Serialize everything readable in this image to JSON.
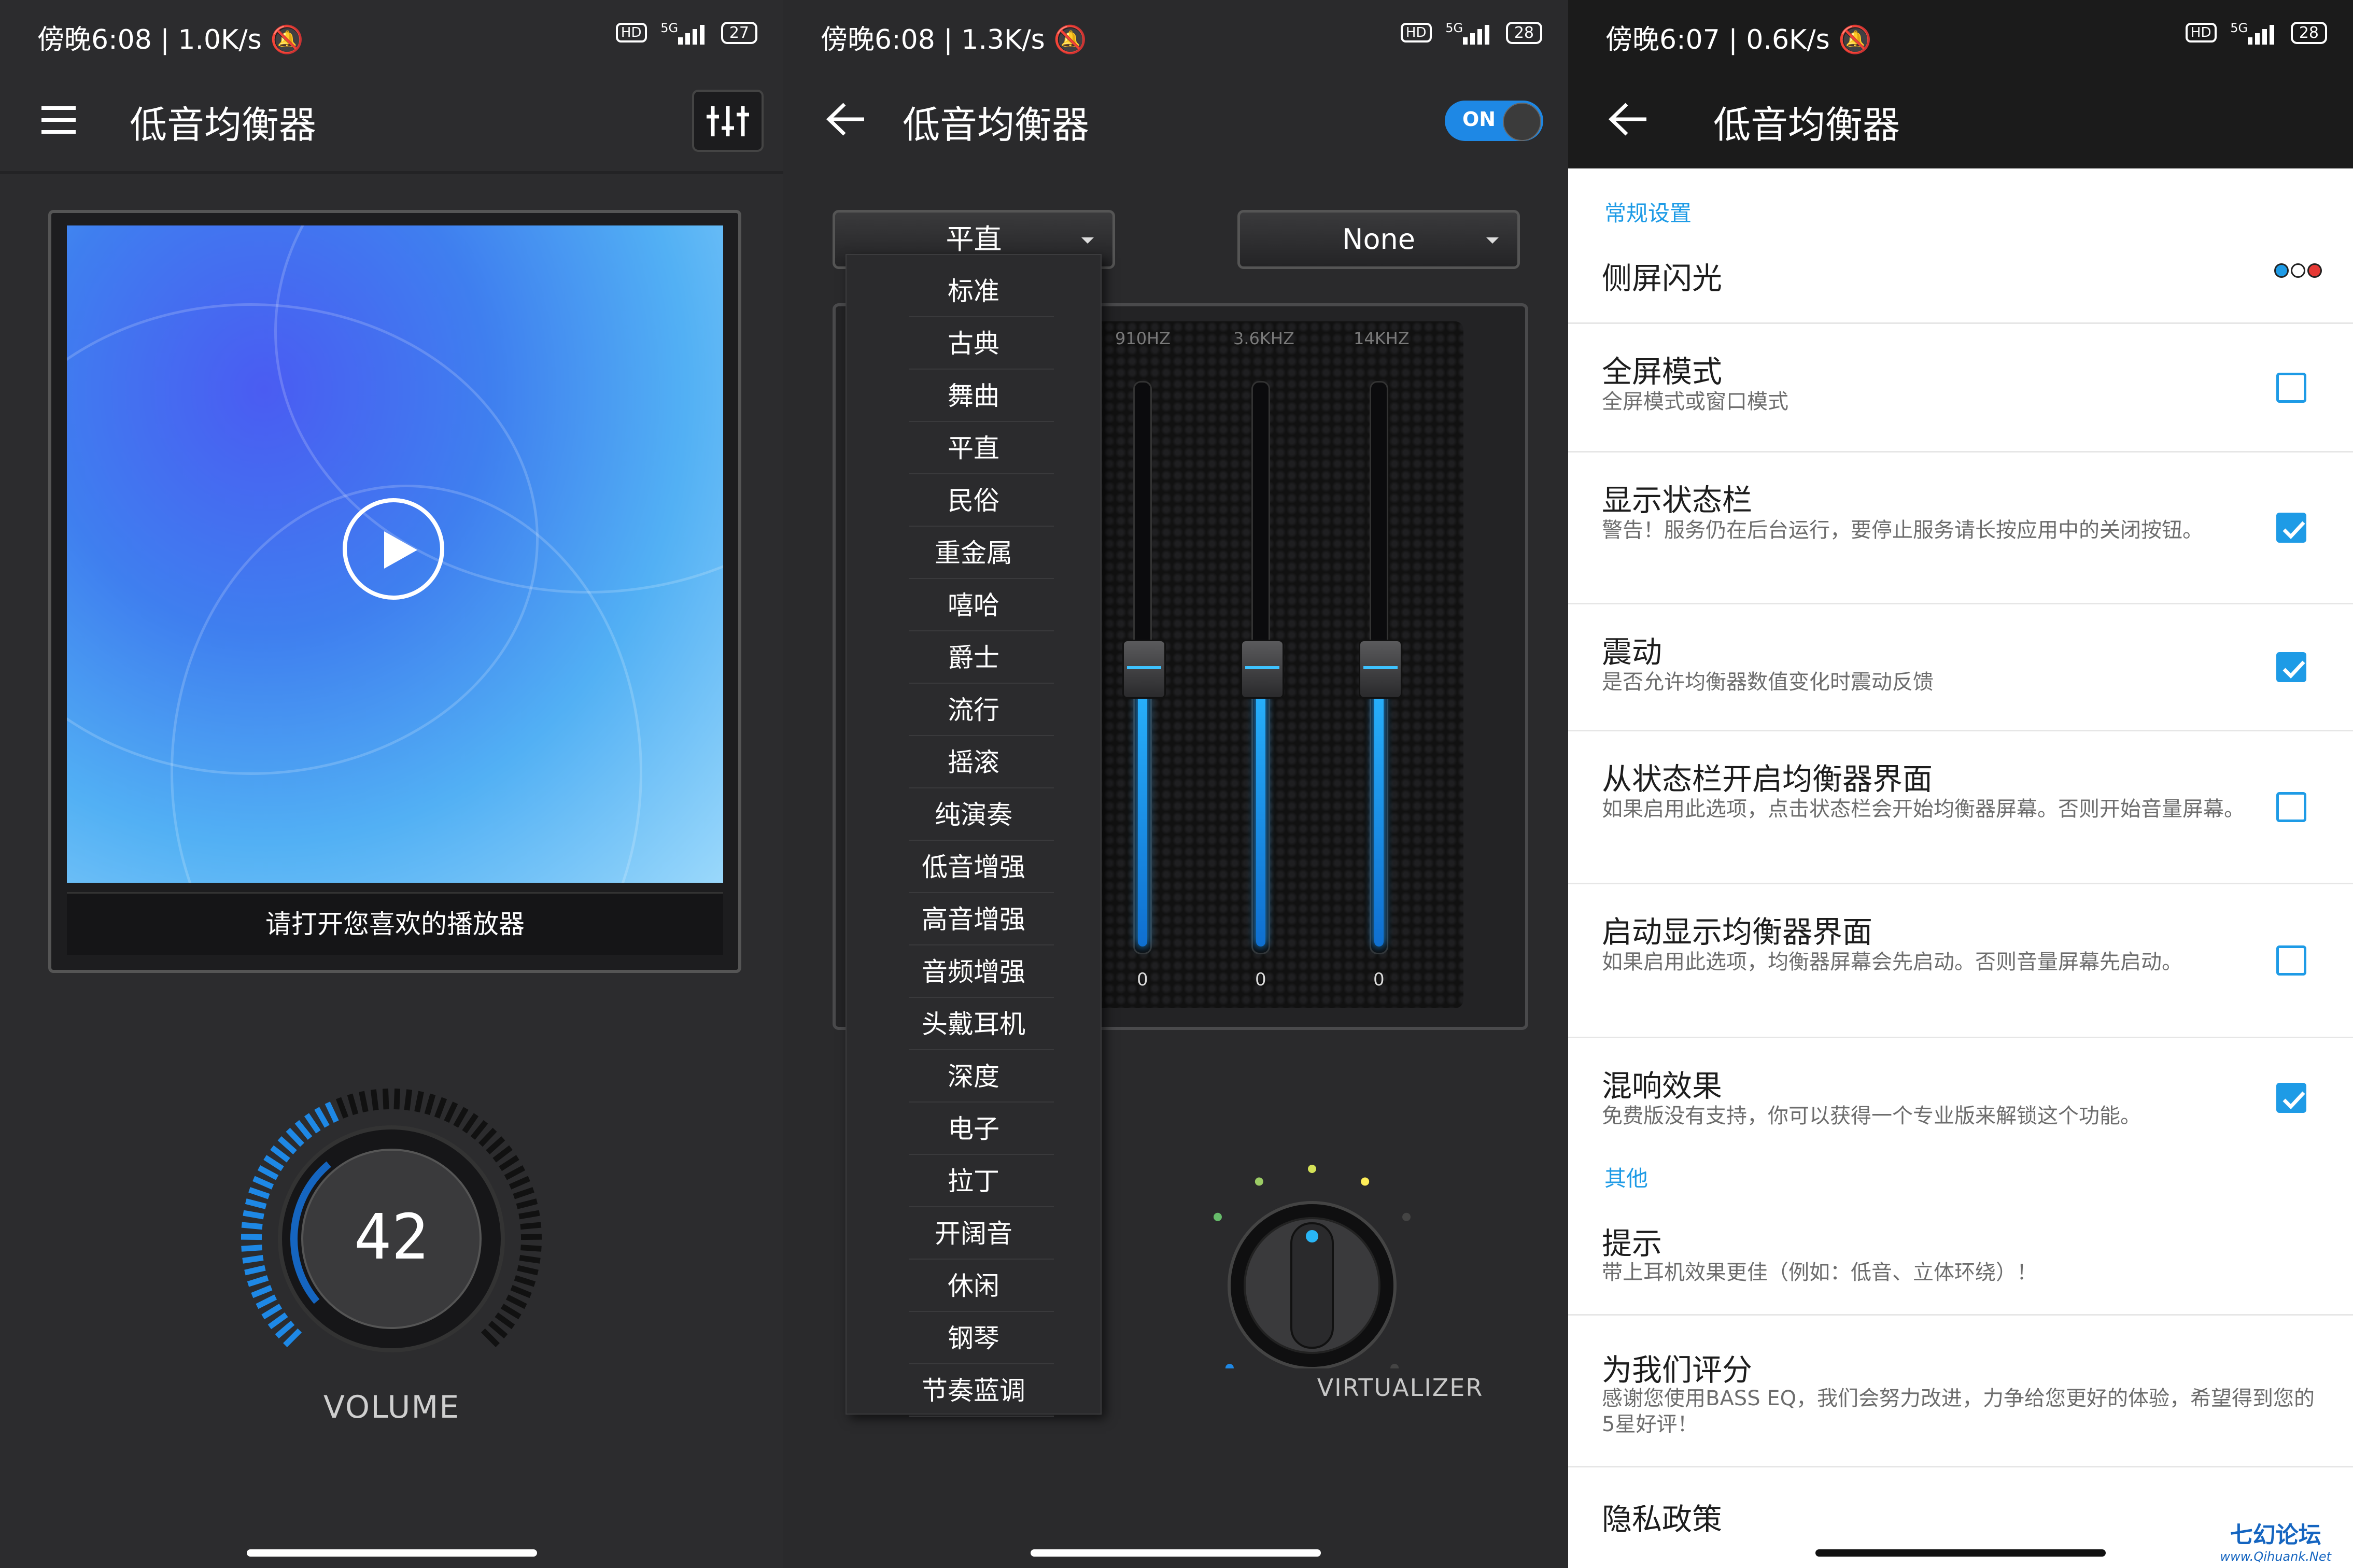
{
  "panel1": {
    "status": {
      "time": "傍晚6:08",
      "speed": "1.0K/s",
      "battery": "27",
      "hd": "HD",
      "net": "5G"
    },
    "title": "低音均衡器",
    "open_player_label": "请打开您喜欢的播放器",
    "volume_value": "42",
    "volume_label": "VOLUME",
    "volume_level": 0.42
  },
  "panel2": {
    "status": {
      "time": "傍晚6:08",
      "speed": "1.3K/s",
      "battery": "28",
      "hd": "HD",
      "net": "5G"
    },
    "title": "低音均衡器",
    "toggle_label": "ON",
    "preset_selected": "平直",
    "reverb_selected": "None",
    "freq_labels": [
      "910HZ",
      "3.6KHZ",
      "14KHZ"
    ],
    "slider_values": [
      "0",
      "0",
      "0"
    ],
    "slider_levels": [
      0.5,
      0.5,
      0.5
    ],
    "presets": [
      "标准",
      "古典",
      "舞曲",
      "平直",
      "民俗",
      "重金属",
      "嘻哈",
      "爵士",
      "流行",
      "摇滚",
      "纯演奏",
      "低音增强",
      "高音增强",
      "音频增强",
      "头戴耳机",
      "深度",
      "电子",
      "拉丁",
      "开阔音",
      "休闲",
      "钢琴",
      "节奏蓝调"
    ],
    "virtualizer_label": "VIRTUALIZER"
  },
  "panel3": {
    "status": {
      "time": "傍晚6:07",
      "speed": "0.6K/s",
      "battery": "28",
      "hd": "HD",
      "net": "5G"
    },
    "title": "低音均衡器",
    "section_general": "常规设置",
    "section_other": "其他",
    "edge_light": {
      "title": "侧屏闪光",
      "colors": [
        "#1e9be6",
        "#ffffff",
        "#e53935"
      ]
    },
    "prefs": [
      {
        "title": "全屏模式",
        "summary": "全屏模式或窗口模式",
        "checked": false
      },
      {
        "title": "显示状态栏",
        "summary": "警告！服务仍在后台运行，要停止服务请长按应用中的关闭按钮。",
        "checked": true
      },
      {
        "title": "震动",
        "summary": "是否允许均衡器数值变化时震动反馈",
        "checked": true
      },
      {
        "title": "从状态栏开启均衡器界面",
        "summary": "如果启用此选项，点击状态栏会开始均衡器屏幕。否则开始音量屏幕。",
        "checked": false
      },
      {
        "title": "启动显示均衡器界面",
        "summary": "如果启用此选项，均衡器屏幕会先启动。否则音量屏幕先启动。",
        "checked": false
      },
      {
        "title": "混响效果",
        "summary": "免费版没有支持，你可以获得一个专业版来解锁这个功能。",
        "checked": true
      }
    ],
    "tip": {
      "title": "提示",
      "summary": "带上耳机效果更佳（例如：低音、立体环绕）！"
    },
    "rate": {
      "title": "为我们评分",
      "summary": "感谢您使用BASS EQ，我们会努力改进，力争给您更好的体验，希望得到您的5星好评！"
    },
    "privacy": {
      "title": "隐私政策"
    },
    "watermark": {
      "name": "七幻论坛",
      "url": "www.Qihuank.Net"
    }
  },
  "colors": {
    "accent": "#1e9be6",
    "eq_blue": "#2ab6ff",
    "dark_bg": "#2a2a2c"
  }
}
